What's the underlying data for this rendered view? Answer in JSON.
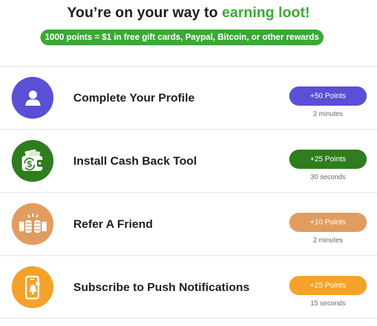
{
  "header": {
    "headline_prefix": "You’re on your way to ",
    "headline_accent": "earning loot!",
    "promo": "1000 points = $1 in free gift cards, Paypal, Bitcoin, or other rewards"
  },
  "colors": {
    "brand_green": "#3aa935",
    "profile": "#5b4fd6",
    "cashback": "#2f7d1f",
    "refer": "#e39c5f",
    "push": "#f4a22a"
  },
  "tasks": [
    {
      "title": "Complete Your Profile",
      "points": "+50 Points",
      "duration": "2 minutes",
      "icon": "user-icon",
      "color": "#5b4fd6"
    },
    {
      "title": "Install Cash Back Tool",
      "points": "+25 Points",
      "duration": "30 seconds",
      "icon": "wallet-cash-icon",
      "color": "#2f7d1f"
    },
    {
      "title": "Refer A Friend",
      "points": "+10 Points",
      "duration": "2 minutes",
      "icon": "fist-bump-icon",
      "color": "#e39c5f"
    },
    {
      "title": "Subscribe to Push Notifications",
      "points": "+25 Points",
      "duration": "15 seconds",
      "icon": "phone-bell-icon",
      "color": "#f4a22a"
    }
  ]
}
